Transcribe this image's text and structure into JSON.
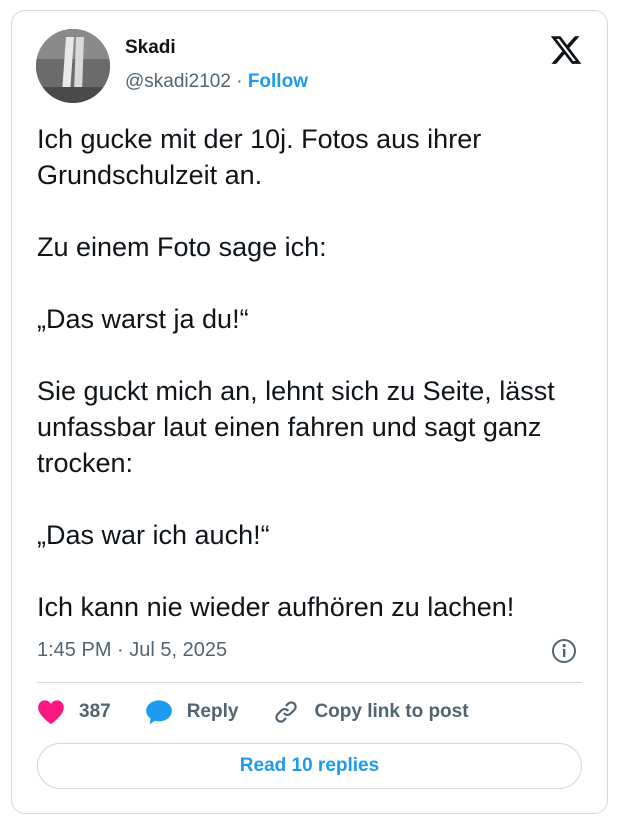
{
  "author": {
    "name": "Skadi",
    "handle": "@skadi2102",
    "separator": " · ",
    "follow_label": "Follow"
  },
  "post": {
    "paragraphs": [
      "Ich gucke mit der 10j. Fotos aus ihrer Grundschulzeit an.",
      "Zu einem Foto sage ich:",
      "„Das warst ja du!“",
      "Sie guckt mich an, lehnt sich zu Seite, lässt unfassbar laut einen fahren und sagt ganz trocken:",
      "„Das war ich auch!“",
      "Ich kann nie wieder aufhören zu lachen!"
    ],
    "timestamp": "1:45 PM · Jul 5, 2025"
  },
  "actions": {
    "like_count": "387",
    "reply_label": "Reply",
    "copy_link_label": "Copy link to post"
  },
  "read_replies_label": "Read 10 replies",
  "icons": {
    "logo": "x-logo-icon",
    "info": "info-icon",
    "like": "heart-icon",
    "reply": "speech-bubble-icon",
    "copy": "link-icon"
  },
  "colors": {
    "accent": "#1d9bf0",
    "like": "#f91880",
    "text": "#0f1419",
    "muted": "#536471",
    "border": "#cfd9de"
  }
}
